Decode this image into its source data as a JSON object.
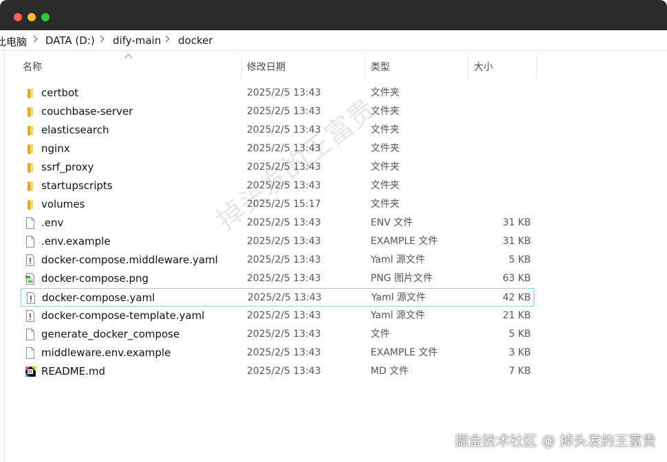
{
  "window": {
    "controls": [
      "close",
      "minimize",
      "maximize"
    ]
  },
  "breadcrumb": [
    "此电脑",
    "DATA (D:)",
    "dify-main",
    "docker"
  ],
  "columns": {
    "name": "名称",
    "date": "修改日期",
    "type": "类型",
    "size": "大小"
  },
  "files": [
    {
      "name": "certbot",
      "date": "2025/2/5 13:43",
      "type": "文件夹",
      "size": "",
      "icon": "folder-icon"
    },
    {
      "name": "couchbase-server",
      "date": "2025/2/5 13:43",
      "type": "文件夹",
      "size": "",
      "icon": "folder-icon"
    },
    {
      "name": "elasticsearch",
      "date": "2025/2/5 13:43",
      "type": "文件夹",
      "size": "",
      "icon": "folder-icon"
    },
    {
      "name": "nginx",
      "date": "2025/2/5 13:43",
      "type": "文件夹",
      "size": "",
      "icon": "folder-icon"
    },
    {
      "name": "ssrf_proxy",
      "date": "2025/2/5 13:43",
      "type": "文件夹",
      "size": "",
      "icon": "folder-icon"
    },
    {
      "name": "startupscripts",
      "date": "2025/2/5 13:43",
      "type": "文件夹",
      "size": "",
      "icon": "folder-icon"
    },
    {
      "name": "volumes",
      "date": "2025/2/5 15:17",
      "type": "文件夹",
      "size": "",
      "icon": "folder-icon"
    },
    {
      "name": ".env",
      "date": "2025/2/5 13:43",
      "type": "ENV 文件",
      "size": "31 KB",
      "icon": "file-icon"
    },
    {
      "name": ".env.example",
      "date": "2025/2/5 13:43",
      "type": "EXAMPLE 文件",
      "size": "31 KB",
      "icon": "file-icon"
    },
    {
      "name": "docker-compose.middleware.yaml",
      "date": "2025/2/5 13:43",
      "type": "Yaml 源文件",
      "size": "5 KB",
      "icon": "yaml-file-icon"
    },
    {
      "name": "docker-compose.png",
      "date": "2025/2/5 13:43",
      "type": "PNG 图片文件",
      "size": "63 KB",
      "icon": "image-file-icon"
    },
    {
      "name": "docker-compose.yaml",
      "date": "2025/2/5 13:43",
      "type": "Yaml 源文件",
      "size": "42 KB",
      "icon": "yaml-file-icon",
      "selected": true
    },
    {
      "name": "docker-compose-template.yaml",
      "date": "2025/2/5 13:43",
      "type": "Yaml 源文件",
      "size": "21 KB",
      "icon": "yaml-file-icon"
    },
    {
      "name": "generate_docker_compose",
      "date": "2025/2/5 13:43",
      "type": "文件",
      "size": "5 KB",
      "icon": "file-icon"
    },
    {
      "name": "middleware.env.example",
      "date": "2025/2/5 13:43",
      "type": "EXAMPLE 文件",
      "size": "3 KB",
      "icon": "file-icon"
    },
    {
      "name": "README.md",
      "date": "2025/2/5 13:43",
      "type": "MD 文件",
      "size": "7 KB",
      "icon": "markdown-app-icon"
    }
  ],
  "watermark": {
    "diagonal": "掉头发的王富贵",
    "corner": "掘金技术社区 @ 掉头发的王富贵"
  },
  "colors": {
    "titlebar": "#2b2b2b",
    "folder": "#f4c542",
    "selection_border": "#99c9ef"
  }
}
